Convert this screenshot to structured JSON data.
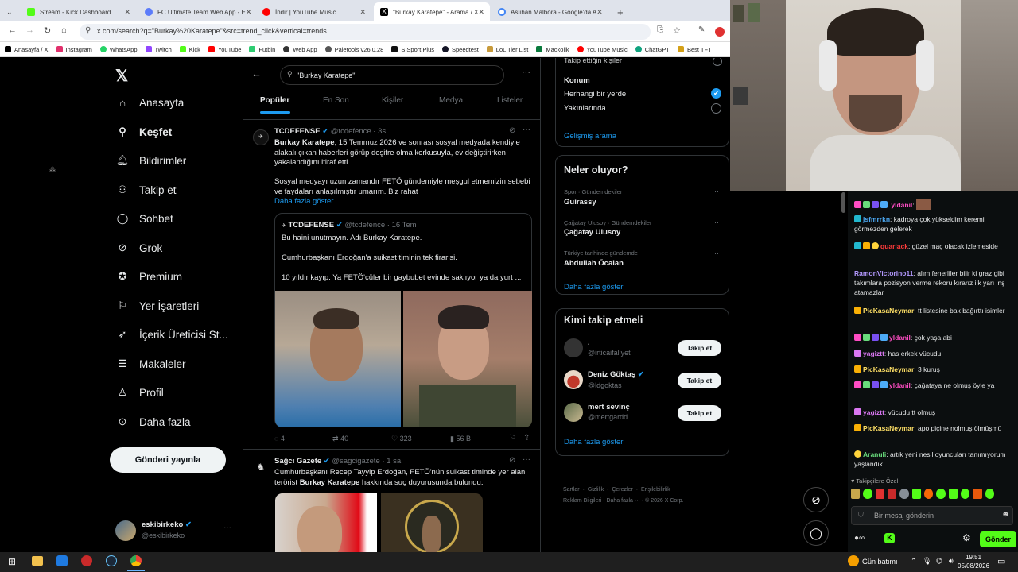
{
  "browser": {
    "tabs": [
      {
        "label": "Stream - Kick Dashboard",
        "color": "#53fc18"
      },
      {
        "label": "FC Ultimate Team Web App - E",
        "color": "#5c7cfa"
      },
      {
        "label": "İndir | YouTube Music",
        "color": "#ff0000"
      },
      {
        "label": "\"Burkay Karatepe\" - Arama / X",
        "color": "#000000"
      },
      {
        "label": "Aslıhan Malbora - Google'da A",
        "color": "#4285f4"
      }
    ],
    "url": "x.com/search?q=\"Burkay%20Karatepe\"&src=trend_click&vertical=trends",
    "bookmarks": [
      {
        "label": "Anasayfa / X",
        "color": "#000000"
      },
      {
        "label": "Instagram",
        "color": "#e1306c"
      },
      {
        "label": "WhatsApp",
        "color": "#25d366"
      },
      {
        "label": "Twitch",
        "color": "#9146ff"
      },
      {
        "label": "Kick",
        "color": "#53fc18"
      },
      {
        "label": "YouTube",
        "color": "#ff0000"
      },
      {
        "label": "Futbin",
        "color": "#2ecc71"
      },
      {
        "label": "Web App",
        "color": "#333333"
      },
      {
        "label": "Paletools v26.0.28",
        "color": "#555555"
      },
      {
        "label": "S Sport Plus",
        "color": "#111111"
      },
      {
        "label": "Speedtest",
        "color": "#141526"
      },
      {
        "label": "LoL Tier List",
        "color": "#c89b3c"
      },
      {
        "label": "Mackolik",
        "color": "#0a7a3d"
      },
      {
        "label": "YouTube Music",
        "color": "#ff0000"
      },
      {
        "label": "ChatGPT",
        "color": "#10a37f"
      },
      {
        "label": "Best TFT",
        "color": "#d4a017"
      }
    ]
  },
  "sidebar": {
    "items": [
      {
        "label": "Anasayfa",
        "icon": "home-icon"
      },
      {
        "label": "Keşfet",
        "icon": "search-icon"
      },
      {
        "label": "Bildirimler",
        "icon": "bell-icon"
      },
      {
        "label": "Takip et",
        "icon": "person-plus-icon"
      },
      {
        "label": "Sohbet",
        "icon": "chat-icon"
      },
      {
        "label": "Grok",
        "icon": "grok-icon"
      },
      {
        "label": "Premium",
        "icon": "premium-icon"
      },
      {
        "label": "Yer İşaretleri",
        "icon": "bookmark-icon"
      },
      {
        "label": "İçerik Üreticisi St...",
        "icon": "rocket-icon"
      },
      {
        "label": "Makaleler",
        "icon": "article-icon"
      },
      {
        "label": "Profil",
        "icon": "person-icon"
      },
      {
        "label": "Daha fazla",
        "icon": "more-circle-icon"
      }
    ],
    "post_button": "Gönderi yayınla",
    "account": {
      "name": "eskibirkeko",
      "handle": "@eskibirkeko"
    }
  },
  "search": {
    "query": "\"Burkay Karatepe\"",
    "tabs": [
      "Popüler",
      "En Son",
      "Kişiler",
      "Medya",
      "Listeler"
    ]
  },
  "tweets": [
    {
      "author": "TCDEFENSE",
      "handle": "@tcdefence",
      "time": "· 3s",
      "text_bold": "Burkay Karatepe",
      "text": ", 15 Temmuz 2026 ve sonrası sosyal medyada kendiyle alakalı çıkan haberleri görüp deşifre olma korkusuyla, ev değiştirirken yakalandığını itiraf etti.",
      "text2": "Sosyal medyayı uzun zamandır FETÖ gündemiyle meşgul etmemizin sebebi ve faydaları anlaşılmıştır umarım. Biz rahat",
      "show_more": "Daha fazla göster",
      "quote": {
        "author": "TCDEFENSE",
        "handle": "@tcdefence",
        "time": "· 16 Tem",
        "line1": "Bu haini unutmayın. Adı Burkay Karatepe.",
        "line2": "Cumhurbaşkanı Erdoğan'a suikast timinin tek firarisi.",
        "line3": "10 yıldır kayıp. Ya FETÖ'cüler bir gaybubet evinde saklıyor ya da yurt ..."
      },
      "stats": {
        "replies": "4",
        "retweets": "40",
        "likes": "323",
        "views": "56 B"
      }
    },
    {
      "author": "Sağcı Gazete",
      "handle": "@sagcigazete",
      "time": "· 1 sa",
      "text": "Cumhurbaşkanı Recep Tayyip Erdoğan, FETÖ'nün suikast timinde yer alan terörist ",
      "text_bold": "Burkay Karatepe",
      "text_end": " hakkında suç duyurusunda bulundu."
    }
  ],
  "filters": {
    "truncated_label": "Takip ettiğin kişiler",
    "location_title": "Konum",
    "opt1": "Herhangi bir yerde",
    "opt2": "Yakınlarında",
    "advanced": "Gelişmiş arama"
  },
  "trends": {
    "title": "Neler oluyor?",
    "items": [
      {
        "meta": "Spor · Gündemdekiler",
        "name": "Guirassy"
      },
      {
        "meta": "Çağatay Ulusoy · Gündemdekiler",
        "name": "Çağatay Ulusoy"
      },
      {
        "meta": "Türkiye tarihinde gündemde",
        "name": "Abdullah Öcalan"
      }
    ],
    "more": "Daha fazla göster"
  },
  "who_to_follow": {
    "title": "Kimi takip etmeli",
    "items": [
      {
        "name": ".",
        "handle": "@irticaifaliyet",
        "button": "Takip et"
      },
      {
        "name": "Deniz Göktaş",
        "handle": "@ldgoktas",
        "button": "Takip et"
      },
      {
        "name": "mert sevinç",
        "handle": "@mertgardd",
        "button": "Takip et"
      }
    ],
    "more": "Daha fazla göster"
  },
  "footer": {
    "line1": [
      "Şartlar",
      "Gizlilik",
      "Çerezler",
      "Erişilebilirlik"
    ],
    "line2": [
      "Reklam Bilgileri",
      "Daha fazla ···",
      "© 2026 X Corp."
    ]
  },
  "chat": {
    "messages": [
      {
        "user": "yldanil",
        "color": "#ff4dc4",
        "text": ""
      },
      {
        "user": "jsfmrrkn",
        "color": "#4dabf7",
        "text": ": kadroya çok yükseldim keremi görmezden gelerek"
      },
      {
        "user": "quarlack",
        "color": "#ff3b3b",
        "text": ": güzel maç olacak izlemeside"
      },
      {
        "user": "RamonVictorino11",
        "color": "#b197fc",
        "text": ": alım fenerliler bilir ki graz gibi takımlara pozisyon verme rekoru kırarız ilk yarı inş atamazlar"
      },
      {
        "user": "PicKasaNeymar",
        "color": "#ffe066",
        "text": ": tt listesine bak bağırttı isimler"
      },
      {
        "user": "yldanil",
        "color": "#ff4dc4",
        "text": ": çok yaşa abi"
      },
      {
        "user": "yagiztt",
        "color": "#da77f2",
        "text": ": has erkek vücudu"
      },
      {
        "user": "PicKasaNeymar",
        "color": "#ffe066",
        "text": ": 3 kuruş"
      },
      {
        "user": "yldanil",
        "color": "#ff4dc4",
        "text": ": çağataya ne olmuş öyle ya"
      },
      {
        "user": "yagiztt",
        "color": "#da77f2",
        "text": ": vücudu tt olmuş"
      },
      {
        "user": "PicKasaNeymar",
        "color": "#ffe066",
        "text": ": apo piçine nolmuş ölmüşmü"
      },
      {
        "user": "Aranuli",
        "color": "#69db7c",
        "text": ": artık yeni nesil oyuncuları tanımıyorum yaşlandık"
      }
    ],
    "followers_only": "Takipçilere Özel",
    "input_placeholder": "Bir mesaj gönderin",
    "send": "Gönder"
  },
  "taskbar": {
    "weather": "Gün batımı",
    "time": "19:51",
    "date": "05/08/2026"
  }
}
